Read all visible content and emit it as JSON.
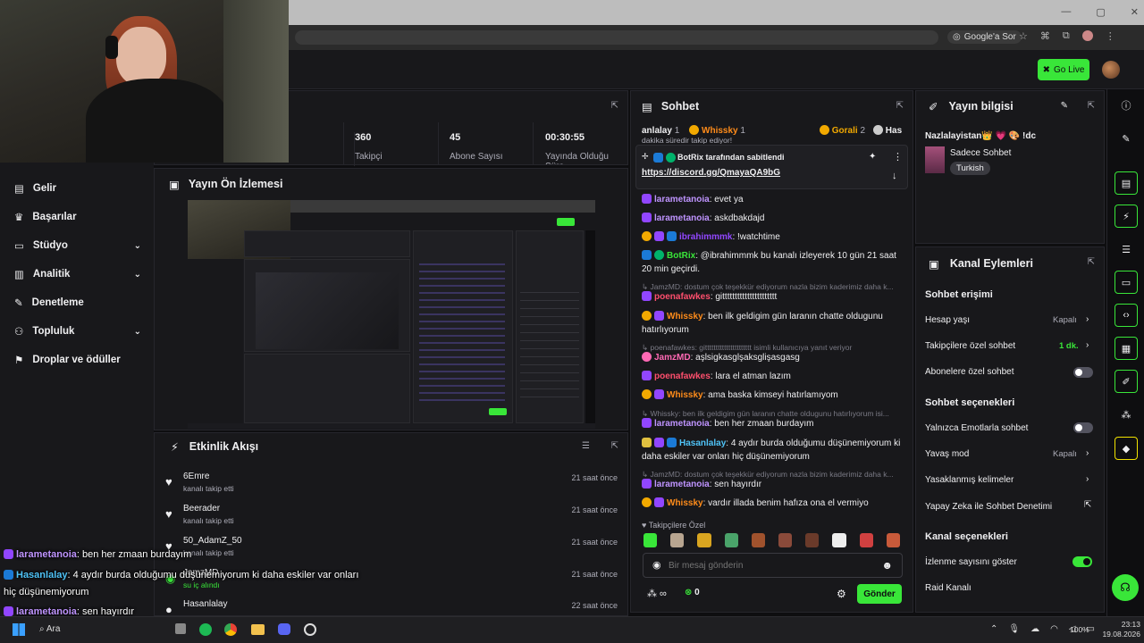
{
  "browser": {
    "google_ask": "Google'a Sor",
    "window_controls": [
      "—",
      "▢",
      "✕"
    ]
  },
  "topnav": {
    "go_live": "Go Live"
  },
  "sidebar": {
    "items": [
      {
        "label": "Gelir",
        "icon": "dollar-icon"
      },
      {
        "label": "Başarılar",
        "icon": "trophy-icon"
      },
      {
        "label": "Stüdyo",
        "icon": "studio-icon",
        "expandable": true
      },
      {
        "label": "Analitik",
        "icon": "chart-icon",
        "expandable": true
      },
      {
        "label": "Denetleme",
        "icon": "sword-icon"
      },
      {
        "label": "Topluluk",
        "icon": "people-icon",
        "expandable": true
      },
      {
        "label": "Droplar ve ödüller",
        "icon": "gift-icon"
      }
    ]
  },
  "stats": [
    {
      "value": "360",
      "label": "Takipçi"
    },
    {
      "value": "45",
      "label": "Abone Sayısı"
    },
    {
      "value": "00:30:55",
      "label": "Yayında Olduğu Süre"
    }
  ],
  "preview": {
    "title": "Yayın Ön İzlemesi"
  },
  "activity": {
    "title": "Etkinlik Akışı",
    "items": [
      {
        "name": "6Emre",
        "desc": "kanalı takip etti",
        "time": "21 saat önce"
      },
      {
        "name": "Beerader",
        "desc": "kanalı takip etti",
        "time": "21 saat önce"
      },
      {
        "name": "50_AdamZ_50",
        "desc": "kanalı takip etti",
        "time": "21 saat önce"
      },
      {
        "name": "JamzMD",
        "desc": "su iç alındı",
        "time": "21 saat önce"
      },
      {
        "name": "Hasanlalay",
        "desc": "",
        "time": "22 saat önce"
      }
    ]
  },
  "chat": {
    "title": "Sohbet",
    "leaderboard": [
      {
        "name": "anlalay",
        "rank": "1"
      },
      {
        "name": "Whissky",
        "rank": "1"
      },
      {
        "name": "Gorali",
        "rank": "2"
      },
      {
        "name": "Has",
        "rank": ""
      }
    ],
    "pinned_cut": "dakika süredir takip ediyor!",
    "pinned_by": "BotRix tarafından sabitlendi",
    "pinned_link": "https://discord.gg/QmayaQA9bG",
    "messages": [
      {
        "user": "larametanoia",
        "color": "#bf94ff",
        "text": "evet ya"
      },
      {
        "user": "larametanoia",
        "color": "#bf94ff",
        "text": "askdbakdajd"
      },
      {
        "user": "ibrahimmmk",
        "color": "#9147ff",
        "text": "!watchtime"
      },
      {
        "user": "BotRix",
        "color": "#39e639",
        "text": "@ibrahimmmk bu kanalı izleyerek 10 gün 21 saat 20 min geçirdi."
      },
      {
        "reply": "JamzMD: dostum çok teşekkür ediyorum nazla bizim kaderimiz daha k..."
      },
      {
        "user": "poenafawkes",
        "color": "#ff4f6d",
        "text": "gitttttttttttttttttttttt"
      },
      {
        "user": "Whissky",
        "color": "#ff8c1a",
        "text": "ben ilk geldigim gün laranın chatte oldugunu hatırlıyorum"
      },
      {
        "reply": "poenafawkes: gitttttttttttttttttttttt isimli kullanıcıya yanıt veriyor"
      },
      {
        "user": "JamzMD",
        "color": "#ff69b4",
        "text": "aşlsigkasglşaksglişasgasg"
      },
      {
        "user": "poenafawkes",
        "color": "#ff4f6d",
        "text": "lara el atman lazım"
      },
      {
        "user": "Whissky",
        "color": "#ff8c1a",
        "text": "ama baska kimseyi hatırlamıyom"
      },
      {
        "reply": "Whissky: ben ilk geldigim gün laranın chatte oldugunu hatırlıyorum isi..."
      },
      {
        "user": "larametanoia",
        "color": "#bf94ff",
        "text": "ben her zmaan burdayım"
      },
      {
        "user": "Hasanlalay",
        "color": "#4fc3f7",
        "text": "4 aydır burda olduğumu düşünemiyorum ki daha eskiler var onları hiç düşünemiyorum"
      },
      {
        "reply": "JamzMD: dostum çok teşekkür ediyorum nazla bizim kaderimiz daha k..."
      },
      {
        "user": "larametanoia",
        "color": "#bf94ff",
        "text": "sen hayırdır"
      },
      {
        "user": "Whissky",
        "color": "#ff8c1a",
        "text": "vardır illada benim hafıza ona el vermiyo"
      }
    ],
    "followers_only": "Takipçilere Özel",
    "input_placeholder": "Bir mesaj gönderin",
    "points": "0",
    "send": "Gönder"
  },
  "stream_info": {
    "title": "Yayın bilgisi",
    "stream_title": "Nazlalayistan👑 💗 🎨 !dc",
    "category": "Sadece Sohbet",
    "tag": "Turkish"
  },
  "channel_actions": {
    "title": "Kanal Eylemleri",
    "chat_access": "Sohbet erişimi",
    "account_age": "Hesap yaşı",
    "account_age_value": "Kapalı",
    "followers_only": "Takipçilere özel sohbet",
    "followers_only_value": "1 dk.",
    "subs_only": "Abonelere özel sohbet",
    "chat_options": "Sohbet seçenekleri",
    "emote_only": "Yalnızca Emotlarla sohbet",
    "slow_mode": "Yavaş mod",
    "slow_mode_value": "Kapalı",
    "banned_words": "Yasaklanmış kelimeler",
    "ai_moderation": "Yapay Zeka ile Sohbet Denetimi",
    "channel_options": "Kanal seçenekleri",
    "show_viewers": "İzlenme sayısını göster",
    "raid": "Raid Kanalı"
  },
  "overlay": [
    {
      "user": "larametanoia",
      "text": ": ben her zmaan burdayım",
      "color": "#bf94ff"
    },
    {
      "user": "Hasanlalay",
      "text": ": 4 aydır burda olduğumu düşünemiyorum ki daha eskiler var onları",
      "color": "#4fc3f7"
    },
    {
      "cont": "hiç düşünemiyorum"
    },
    {
      "user": "larametanoia",
      "text": ": sen hayırdır",
      "color": "#bf94ff"
    }
  ],
  "taskbar": {
    "search": "Ara",
    "battery": "100%",
    "time": "23:13",
    "date": "19.08.2026"
  }
}
